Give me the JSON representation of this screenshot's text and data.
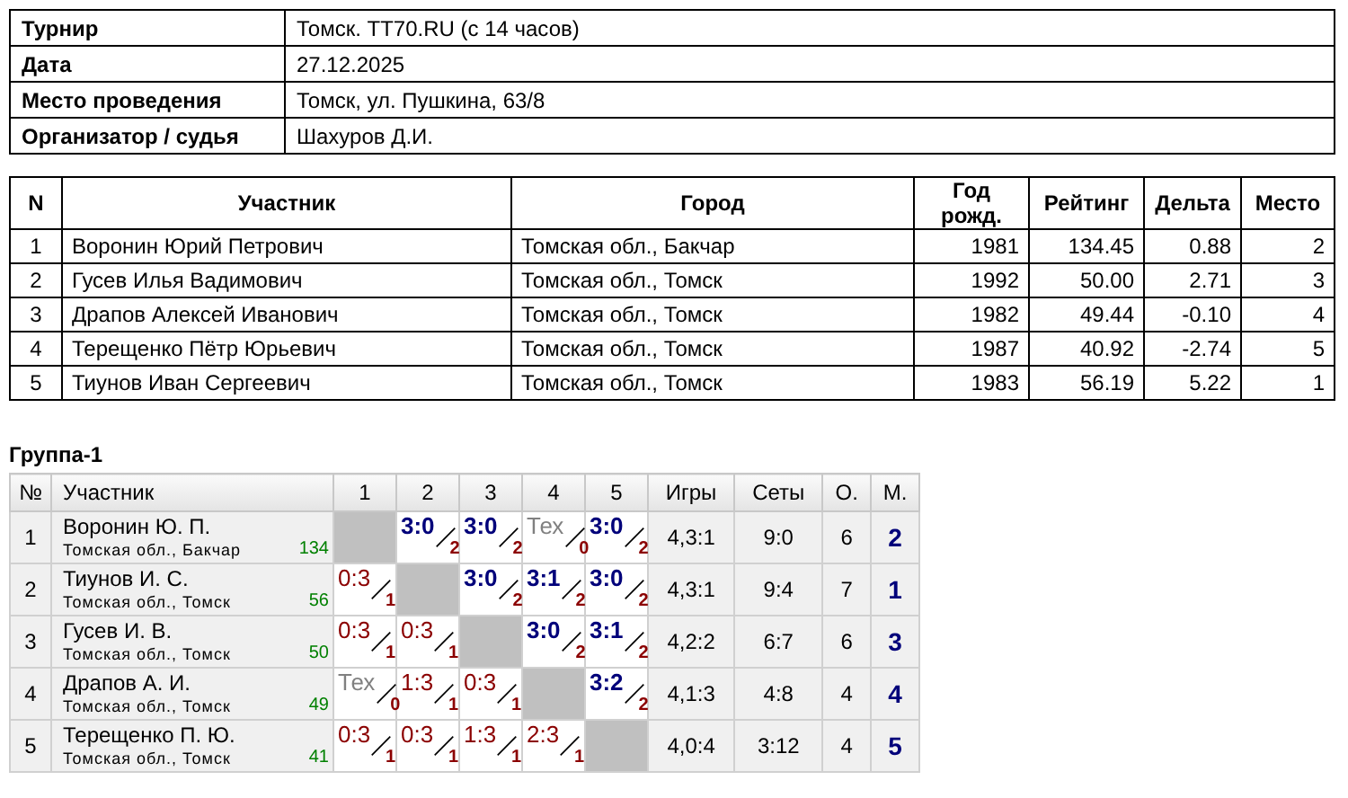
{
  "info": [
    {
      "label": "Турнир",
      "value": "Томск. TT70.RU (с 14 часов)"
    },
    {
      "label": "Дата",
      "value": "27.12.2025"
    },
    {
      "label": "Место проведения",
      "value": "Томск, ул. Пушкина, 63/8"
    },
    {
      "label": "Организатор / судья",
      "value": "Шахуров Д.И."
    }
  ],
  "participants": {
    "columns": [
      "N",
      "Участник",
      "Город",
      "Год рожд.",
      "Рейтинг",
      "Дельта",
      "Место"
    ],
    "rows": [
      [
        "1",
        "Воронин Юрий Петрович",
        "Томская обл., Бакчар",
        "1981",
        "134.45",
        "0.88",
        "2"
      ],
      [
        "2",
        "Гусев Илья Вадимович",
        "Томская обл., Томск",
        "1992",
        "50.00",
        "2.71",
        "3"
      ],
      [
        "3",
        "Драпов Алексей Иванович",
        "Томская обл., Томск",
        "1982",
        "49.44",
        "-0.10",
        "4"
      ],
      [
        "4",
        "Терещенко Пётр Юрьевич",
        "Томская обл., Томск",
        "1987",
        "40.92",
        "-2.74",
        "5"
      ],
      [
        "5",
        "Тиунов Иван Сергеевич",
        "Томская обл., Томск",
        "1983",
        "56.19",
        "5.22",
        "1"
      ]
    ]
  },
  "group": {
    "title": "Группа-1",
    "columns": [
      "№",
      "Участник",
      "1",
      "2",
      "3",
      "4",
      "5",
      "Игры",
      "Сеты",
      "О.",
      "М."
    ],
    "rows": [
      {
        "num": "1",
        "name": "Воронин Ю. П.",
        "region": "Томская обл., Бакчар",
        "rating": "134",
        "results": [
          {
            "kind": "self"
          },
          {
            "kind": "win",
            "score": "3:0",
            "points": "2"
          },
          {
            "kind": "win",
            "score": "3:0",
            "points": "2"
          },
          {
            "kind": "tech",
            "score": "Тех",
            "points": "0"
          },
          {
            "kind": "win",
            "score": "3:0",
            "points": "2"
          }
        ],
        "games": "4,3:1",
        "sets": "9:0",
        "points": "6",
        "place": "2"
      },
      {
        "num": "2",
        "name": "Тиунов И. С.",
        "region": "Томская обл., Томск",
        "rating": "56",
        "results": [
          {
            "kind": "loss",
            "score": "0:3",
            "points": "1"
          },
          {
            "kind": "self"
          },
          {
            "kind": "win",
            "score": "3:0",
            "points": "2"
          },
          {
            "kind": "win",
            "score": "3:1",
            "points": "2"
          },
          {
            "kind": "win",
            "score": "3:0",
            "points": "2"
          }
        ],
        "games": "4,3:1",
        "sets": "9:4",
        "points": "7",
        "place": "1"
      },
      {
        "num": "3",
        "name": "Гусев И. В.",
        "region": "Томская обл., Томск",
        "rating": "50",
        "results": [
          {
            "kind": "loss",
            "score": "0:3",
            "points": "1"
          },
          {
            "kind": "loss",
            "score": "0:3",
            "points": "1"
          },
          {
            "kind": "self"
          },
          {
            "kind": "win",
            "score": "3:0",
            "points": "2"
          },
          {
            "kind": "win",
            "score": "3:1",
            "points": "2"
          }
        ],
        "games": "4,2:2",
        "sets": "6:7",
        "points": "6",
        "place": "3"
      },
      {
        "num": "4",
        "name": "Драпов А. И.",
        "region": "Томская обл., Томск",
        "rating": "49",
        "results": [
          {
            "kind": "tech",
            "score": "Тех",
            "points": "0"
          },
          {
            "kind": "loss",
            "score": "1:3",
            "points": "1"
          },
          {
            "kind": "loss",
            "score": "0:3",
            "points": "1"
          },
          {
            "kind": "self"
          },
          {
            "kind": "win",
            "score": "3:2",
            "points": "2"
          }
        ],
        "games": "4,1:3",
        "sets": "4:8",
        "points": "4",
        "place": "4"
      },
      {
        "num": "5",
        "name": "Терещенко П. Ю.",
        "region": "Томская обл., Томск",
        "rating": "41",
        "results": [
          {
            "kind": "loss",
            "score": "0:3",
            "points": "1"
          },
          {
            "kind": "loss",
            "score": "0:3",
            "points": "1"
          },
          {
            "kind": "loss",
            "score": "1:3",
            "points": "1"
          },
          {
            "kind": "loss",
            "score": "2:3",
            "points": "1"
          },
          {
            "kind": "self"
          }
        ],
        "games": "4,0:4",
        "sets": "3:12",
        "points": "4",
        "place": "5"
      }
    ]
  }
}
